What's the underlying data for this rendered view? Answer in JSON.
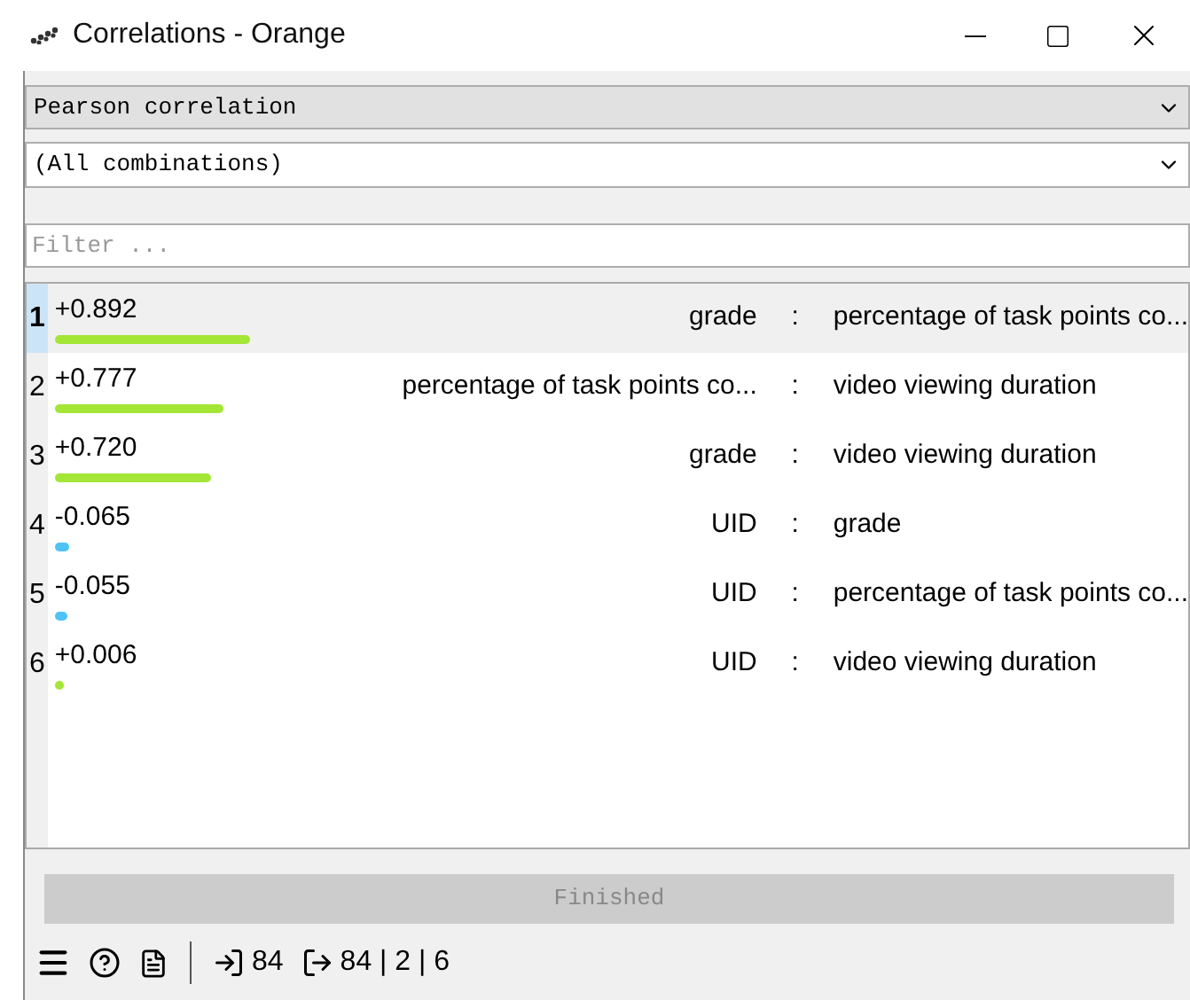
{
  "window": {
    "title": "Correlations - Orange"
  },
  "method_dropdown": {
    "value": "Pearson correlation"
  },
  "feature_dropdown": {
    "value": "(All combinations)"
  },
  "filter": {
    "placeholder": "Filter ..."
  },
  "rows": [
    {
      "index": "1",
      "value": "+0.892",
      "color": "#a3e635",
      "left": "grade",
      "sep": ":",
      "right": "percentage of task points co...",
      "selected": true
    },
    {
      "index": "2",
      "value": "+0.777",
      "color": "#a3e635",
      "left": "percentage of task points co...",
      "sep": ":",
      "right": "video viewing duration",
      "selected": false
    },
    {
      "index": "3",
      "value": "+0.720",
      "color": "#a3e635",
      "left": "grade",
      "sep": ":",
      "right": "video viewing duration",
      "selected": false
    },
    {
      "index": "4",
      "value": "-0.065",
      "color": "#4fc3f7",
      "left": "UID",
      "sep": ":",
      "right": "grade",
      "selected": false
    },
    {
      "index": "5",
      "value": "-0.055",
      "color": "#4fc3f7",
      "left": "UID",
      "sep": ":",
      "right": "percentage of task points co...",
      "selected": false
    },
    {
      "index": "6",
      "value": "+0.006",
      "color": "#a3e635",
      "left": "UID",
      "sep": ":",
      "right": "video viewing duration",
      "selected": false
    }
  ],
  "progress": {
    "label": "Finished"
  },
  "status_bar": {
    "input_count": "84",
    "output_count": "84 | 2 | 6"
  }
}
